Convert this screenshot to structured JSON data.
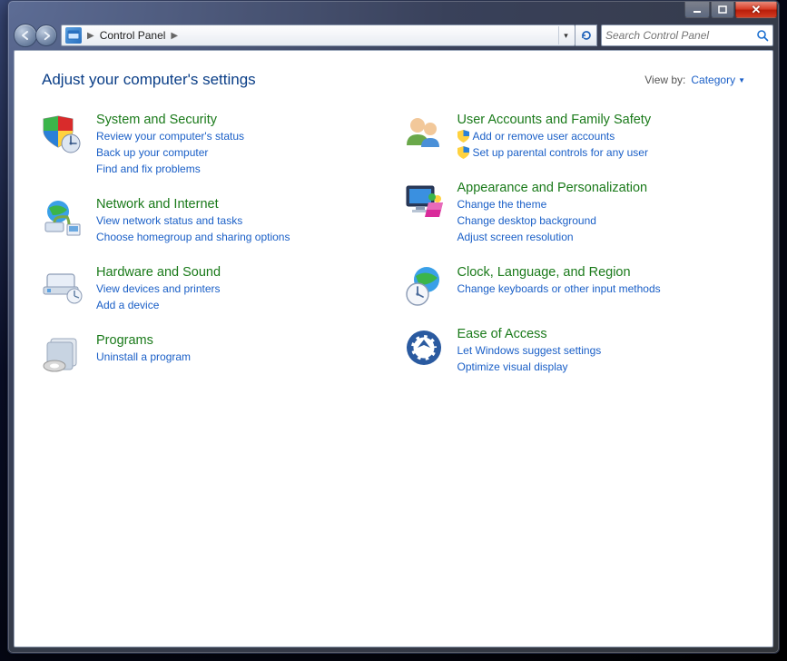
{
  "breadcrumb": {
    "root": "Control Panel"
  },
  "search": {
    "placeholder": "Search Control Panel"
  },
  "page_title": "Adjust your computer's settings",
  "viewby": {
    "label": "View by:",
    "value": "Category"
  },
  "left": [
    {
      "title": "System and Security",
      "links": [
        {
          "label": "Review your computer's status"
        },
        {
          "label": "Back up your computer"
        },
        {
          "label": "Find and fix problems"
        }
      ]
    },
    {
      "title": "Network and Internet",
      "links": [
        {
          "label": "View network status and tasks"
        },
        {
          "label": "Choose homegroup and sharing options"
        }
      ]
    },
    {
      "title": "Hardware and Sound",
      "links": [
        {
          "label": "View devices and printers"
        },
        {
          "label": "Add a device"
        }
      ]
    },
    {
      "title": "Programs",
      "links": [
        {
          "label": "Uninstall a program"
        }
      ]
    }
  ],
  "right": [
    {
      "title": "User Accounts and Family Safety",
      "links": [
        {
          "label": "Add or remove user accounts",
          "shield": true
        },
        {
          "label": "Set up parental controls for any user",
          "shield": true
        }
      ]
    },
    {
      "title": "Appearance and Personalization",
      "links": [
        {
          "label": "Change the theme"
        },
        {
          "label": "Change desktop background"
        },
        {
          "label": "Adjust screen resolution"
        }
      ]
    },
    {
      "title": "Clock, Language, and Region",
      "links": [
        {
          "label": "Change keyboards or other input methods"
        }
      ]
    },
    {
      "title": "Ease of Access",
      "links": [
        {
          "label": "Let Windows suggest settings"
        },
        {
          "label": "Optimize visual display"
        }
      ]
    }
  ]
}
